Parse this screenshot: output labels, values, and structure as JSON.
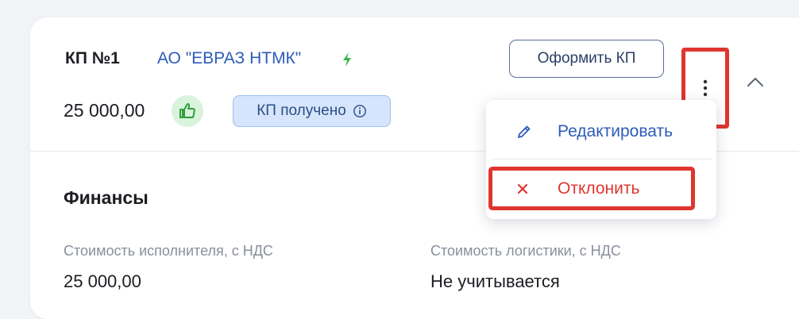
{
  "header": {
    "kp_number": "КП №1",
    "company": "АО \"ЕВРАЗ НТМК\"",
    "price": "25 000,00",
    "status": "КП получено",
    "offer_button": "Оформить КП"
  },
  "menu": {
    "edit_label": "Редактировать",
    "reject_label": "Отклонить"
  },
  "finances": {
    "title": "Финансы",
    "fields": [
      {
        "label": "Стоимость исполнителя, с НДС",
        "value": "25 000,00"
      },
      {
        "label": "Стоимость логистики, с НДС",
        "value": "Не учитывается"
      }
    ]
  },
  "colors": {
    "accent": "#2e5bb8",
    "danger": "#e0352f",
    "success": "#3bb54a",
    "status_bg": "#d6e5fb"
  },
  "icons": [
    "bolt-icon",
    "thumbs-up-icon",
    "info-icon",
    "more-vertical-icon",
    "chevron-up-icon",
    "pencil-icon",
    "close-icon"
  ]
}
